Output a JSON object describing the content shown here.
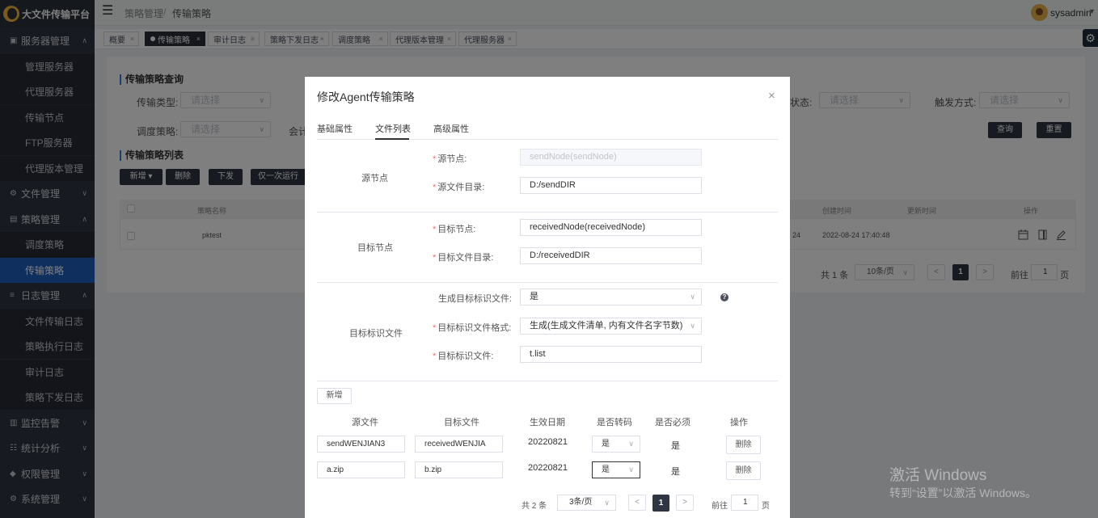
{
  "app": {
    "title": "大文件传输平台"
  },
  "sidebar": {
    "items": [
      {
        "type": "group",
        "label": "服务器管理",
        "icon": "cube-icon",
        "caret": "up"
      },
      {
        "type": "sub",
        "label": "管理服务器"
      },
      {
        "type": "sub",
        "label": "代理服务器"
      },
      {
        "type": "sub",
        "label": "传输节点"
      },
      {
        "type": "sub",
        "label": "FTP服务器"
      },
      {
        "type": "sub",
        "label": "代理版本管理"
      },
      {
        "type": "group",
        "label": "文件管理",
        "icon": "gear-icon",
        "caret": "down"
      },
      {
        "type": "group",
        "label": "策略管理",
        "icon": "cart-icon",
        "caret": "up"
      },
      {
        "type": "sub",
        "label": "调度策略"
      },
      {
        "type": "sub",
        "label": "传输策略",
        "active": true
      },
      {
        "type": "group",
        "label": "日志管理",
        "icon": "list-icon",
        "caret": "up"
      },
      {
        "type": "sub",
        "label": "文件传输日志"
      },
      {
        "type": "sub",
        "label": "策略执行日志"
      },
      {
        "type": "sub",
        "label": "审计日志"
      },
      {
        "type": "sub",
        "label": "策略下发日志"
      },
      {
        "type": "group",
        "label": "监控告警",
        "icon": "monitor-icon",
        "caret": "down"
      },
      {
        "type": "group",
        "label": "统计分析",
        "icon": "chart-icon",
        "caret": "down"
      },
      {
        "type": "group",
        "label": "权限管理",
        "icon": "lock-icon",
        "caret": "down"
      },
      {
        "type": "group",
        "label": "系统管理",
        "icon": "settings-icon",
        "caret": "down"
      }
    ]
  },
  "header": {
    "breadcrumb": [
      "策略管理",
      "传输策略"
    ],
    "separator": "/",
    "user": "sysadmin"
  },
  "tabs": [
    {
      "label": "概要",
      "active": false
    },
    {
      "label": "传输策略",
      "active": true
    },
    {
      "label": "审计日志",
      "active": false
    },
    {
      "label": "策略下发日志",
      "active": false
    },
    {
      "label": "调度策略",
      "active": false
    },
    {
      "label": "代理版本管理",
      "active": false
    },
    {
      "label": "代理服务器",
      "active": false
    }
  ],
  "query": {
    "title": "传输策略查询",
    "type_label": "传输类型:",
    "schedule_label": "调度策略:",
    "audit_label": "会计",
    "status_label": "状态:",
    "trigger_label": "触发方式:",
    "placeholder": "请选择",
    "search_btn": "查询",
    "reset_btn": "重置"
  },
  "list": {
    "title": "传输策略列表",
    "buttons": {
      "add": "新增",
      "delete": "删除",
      "issue": "下发",
      "run_once": "仅一次运行"
    },
    "columns": {
      "name": "策略名称",
      "created": "创建时间",
      "updated": "更新时间",
      "ops": "操作"
    },
    "rows": [
      {
        "name": "pktest",
        "partial": "24",
        "created": "2022-08-24 17:40:48",
        "updated": ""
      }
    ],
    "pagination": {
      "total": "共 1 条",
      "page_size": "10条/页",
      "current": "1",
      "goto_label": "前往",
      "goto_value": "1",
      "page_unit": "页"
    }
  },
  "modal": {
    "title": "修改Agent传输策略",
    "tabs": [
      "基础属性",
      "文件列表",
      "高级属性"
    ],
    "active_tab": 1,
    "source_group": "源节点",
    "source_node_label": "源节点:",
    "source_node_value": "sendNode(sendNode)",
    "source_dir_label": "源文件目录:",
    "source_dir_value": "D:/sendDIR",
    "target_group": "目标节点",
    "target_node_label": "目标节点:",
    "target_node_value": "receivedNode(receivedNode)",
    "target_dir_label": "目标文件目录:",
    "target_dir_value": "D:/receivedDIR",
    "flag_group": "目标标识文件",
    "gen_flag_label": "生成目标标识文件:",
    "gen_flag_value": "是",
    "flag_format_label": "目标标识文件格式:",
    "flag_format_value": "生成(生成文件清单, 内有文件名字节数)",
    "flag_file_label": "目标标识文件:",
    "flag_file_value": "t.list",
    "help": "?",
    "add_btn": "新增",
    "file_table": {
      "headers": [
        "源文件",
        "目标文件",
        "生效日期",
        "是否转码",
        "是否必须",
        "操作"
      ],
      "rows": [
        {
          "src": "sendWENJIAN3",
          "dst": "receivedWENJIA",
          "date": "20220821",
          "transcode": "是",
          "required": "是",
          "op": "删除"
        },
        {
          "src": "a.zip",
          "dst": "b.zip",
          "date": "20220821",
          "transcode": "是",
          "required": "是",
          "op": "删除"
        }
      ]
    },
    "pagination": {
      "total": "共 2 条",
      "page_size": "3条/页",
      "current": "1",
      "goto_label": "前往",
      "goto_value": "1",
      "page_unit": "页"
    }
  },
  "watermark": {
    "line1": "激活 Windows",
    "line2": "转到“设置”以激活 Windows。"
  }
}
